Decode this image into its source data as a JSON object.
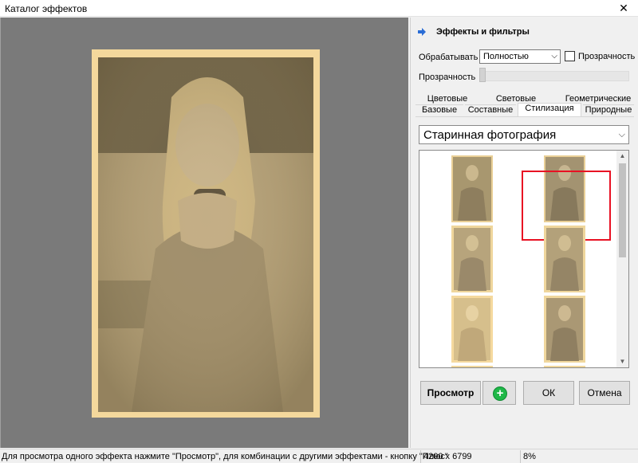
{
  "window": {
    "title": "Каталог эффектов",
    "close_glyph": "✕"
  },
  "panel": {
    "header": "Эффекты и фильтры",
    "process_label": "Обрабатывать",
    "process_value": "Полностью",
    "transparency_checkbox_label": "Прозрачность",
    "transparency_checked": false,
    "transparency_slider_label": "Прозрачность",
    "transparency_slider_value": 0,
    "tabs_back": [
      "Цветовые",
      "Световые",
      "Геометрические"
    ],
    "tabs_front": [
      "Базовые",
      "Составные",
      "Стилизация",
      "Природные"
    ],
    "active_tab": "Стилизация",
    "effect_value": "Старинная фотография",
    "selected_thumbnail": 2
  },
  "buttons": {
    "preview": "Просмотр",
    "add": "+",
    "ok": "ОК",
    "cancel": "Отмена"
  },
  "status": {
    "message": "Для просмотра одного эффекта нажмите \"Просмотр\", для комбинации с другими эффектами - кнопку \"Плюс\"",
    "image_size": "4200 x 6799",
    "zoom": "8%"
  },
  "colors": {
    "sepia": "#f4d89c",
    "accent_blue": "#2a6dd6",
    "selection_red": "#e81123",
    "plus_green": "#1fb848"
  },
  "icons": {
    "header_icon": "blue-arrow-icon",
    "add_icon": "plus-circle-icon"
  }
}
